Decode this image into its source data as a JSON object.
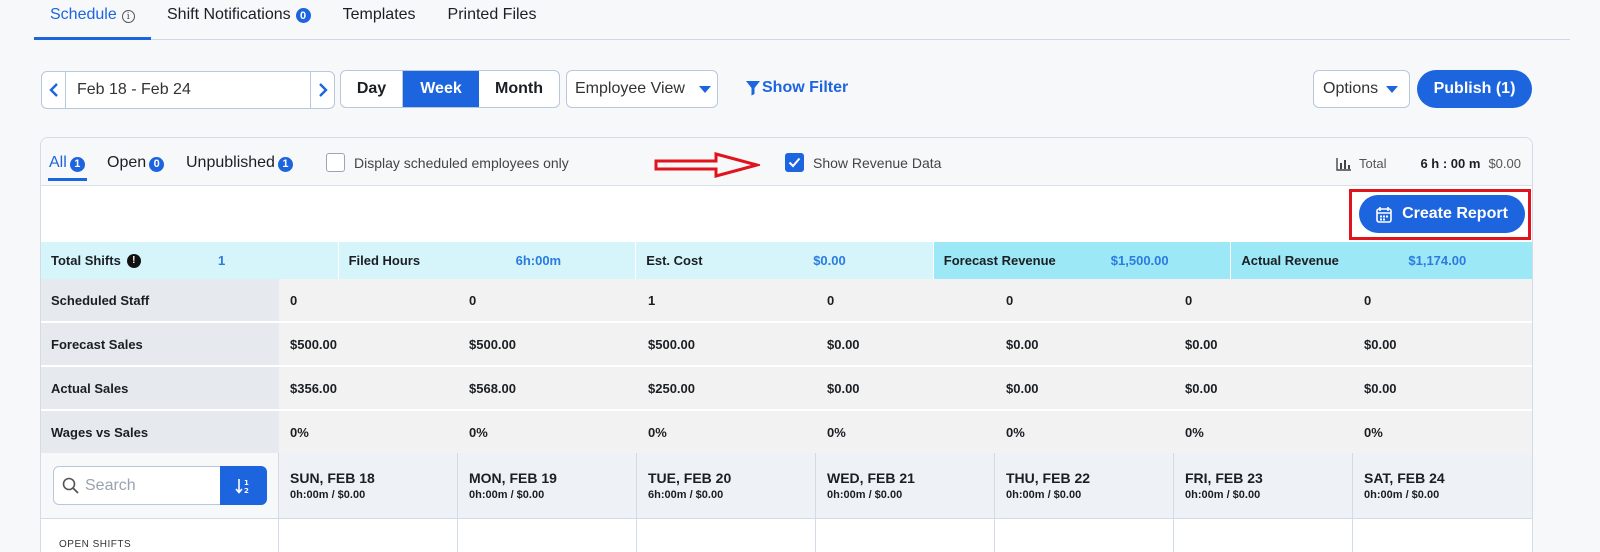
{
  "top_tabs": [
    {
      "label": "Schedule",
      "active": true,
      "info": "i"
    },
    {
      "label": "Shift Notifications",
      "badge": "0"
    },
    {
      "label": "Templates"
    },
    {
      "label": "Printed Files"
    }
  ],
  "toolbar": {
    "date_range": "Feb 18 - Feb 24",
    "views": {
      "day": "Day",
      "week": "Week",
      "month": "Month"
    },
    "active_view": "Week",
    "employee_view": "Employee View",
    "show_filter": "Show Filter",
    "options": "Options",
    "publish": "Publish (1)"
  },
  "filter_bar": {
    "tabs": [
      {
        "label": "All",
        "badge": "1",
        "active": true
      },
      {
        "label": "Open",
        "badge": "0"
      },
      {
        "label": "Unpublished",
        "badge": "1"
      }
    ],
    "scheduled_only": {
      "label": "Display scheduled employees only",
      "checked": false
    },
    "show_revenue": {
      "label": "Show Revenue Data",
      "checked": true
    },
    "total": {
      "label": "Total",
      "hours": "6 h : 00 m",
      "cost": "$0.00"
    }
  },
  "create_report": "Create Report",
  "summary": {
    "total_shifts": {
      "label": "Total Shifts",
      "value": "1"
    },
    "filed_hours": {
      "label": "Filed Hours",
      "value": "6h:00m"
    },
    "est_cost": {
      "label": "Est. Cost",
      "value": "$0.00"
    },
    "forecast_revenue": {
      "label": "Forecast Revenue",
      "value": "$1,500.00"
    },
    "actual_revenue": {
      "label": "Actual Revenue",
      "value": "$1,174.00"
    }
  },
  "metrics": [
    {
      "label": "Scheduled Staff",
      "values": [
        "0",
        "0",
        "1",
        "0",
        "0",
        "0",
        "0"
      ]
    },
    {
      "label": "Forecast Sales",
      "values": [
        "$500.00",
        "$500.00",
        "$500.00",
        "$0.00",
        "$0.00",
        "$0.00",
        "$0.00"
      ]
    },
    {
      "label": "Actual Sales",
      "values": [
        "$356.00",
        "$568.00",
        "$250.00",
        "$0.00",
        "$0.00",
        "$0.00",
        "$0.00"
      ]
    },
    {
      "label": "Wages vs Sales",
      "values": [
        "0%",
        "0%",
        "0%",
        "0%",
        "0%",
        "0%",
        "0%"
      ]
    }
  ],
  "search": {
    "placeholder": "Search"
  },
  "days": [
    {
      "name": "SUN, FEB 18",
      "sub": "0h:00m / $0.00"
    },
    {
      "name": "MON, FEB 19",
      "sub": "0h:00m / $0.00"
    },
    {
      "name": "TUE, FEB 20",
      "sub": "6h:00m / $0.00"
    },
    {
      "name": "WED, FEB 21",
      "sub": "0h:00m / $0.00"
    },
    {
      "name": "THU, FEB 22",
      "sub": "0h:00m / $0.00"
    },
    {
      "name": "FRI, FEB 23",
      "sub": "0h:00m / $0.00"
    },
    {
      "name": "SAT, FEB 24",
      "sub": "0h:00m / $0.00"
    }
  ],
  "open_shifts_label": "OPEN SHIFTS",
  "colors": {
    "accent": "#1d64df",
    "highlight": "#e0141c",
    "summary_light": "#d5f5fb",
    "summary_strong": "#9de8f6"
  }
}
